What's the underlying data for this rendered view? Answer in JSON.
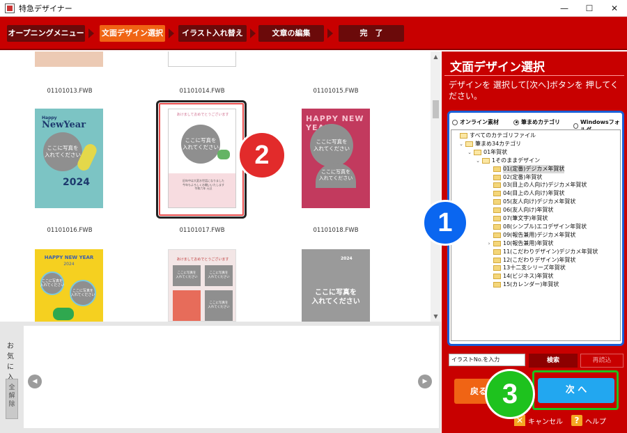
{
  "window": {
    "title": "特急デザイナー",
    "minimize": "—",
    "maximize": "☐",
    "close": "✕"
  },
  "steps": [
    {
      "label": "オープニングメニュー"
    },
    {
      "label": "文面デザイン選択"
    },
    {
      "label": "イラスト入れ替え"
    },
    {
      "label": "文章の編集"
    },
    {
      "label": "完　了"
    }
  ],
  "thumbnails": {
    "filenames": [
      "01101013.FWB",
      "01101014.FWB",
      "01101015.FWB",
      "01101016.FWB",
      "01101017.FWB",
      "01101018.FWB"
    ],
    "card1": {
      "brand": "Happy",
      "title": "NewYear",
      "photo": "ここに写真を\n入れてください",
      "year": "2024"
    },
    "card2": {
      "header": "あけましておめでとうございます",
      "photo": "ここに写真を\n入れてください",
      "msg": "旧年中は大変お世話になりました\n今年もよろしくお願いいたします\n令和六年 元旦"
    },
    "card3": {
      "title": "HAPPY NEW YEAR",
      "photo": "ここに写真を\n入れてください",
      "photo_small": "ここに写真を\n入れてください"
    },
    "card4": {
      "title": "HAPPY NEW YEAR",
      "year": "2024",
      "photo": "ここに写真を\n入れてください"
    },
    "card5": {
      "header": "あけましておめでとうございます",
      "photo": "ここに写真を\n入れてください"
    },
    "card6": {
      "year": "2024",
      "photo": "ここに写真を\n入れてください"
    }
  },
  "favorites": {
    "label": "お気に入り",
    "clear": "全解除",
    "prev": "◀",
    "next": "▶"
  },
  "panel": {
    "title": "文面デザイン選択",
    "description": "デザインを 選択して[次へ]ボタンを 押してください。",
    "radios": [
      {
        "label": "オンライン素材",
        "checked": false
      },
      {
        "label": "筆まめカテゴリ",
        "checked": true
      },
      {
        "label": "Windowsフォルダ",
        "checked": false
      }
    ],
    "tree": [
      {
        "label": "すべてのカテゴリファイル",
        "expander": "",
        "level": 0
      },
      {
        "label": "筆まめ34カテゴリ",
        "expander": "⌄",
        "level": 1
      },
      {
        "label": "01年賀状",
        "expander": "⌄",
        "level": 2
      },
      {
        "label": "1そのままデザイン",
        "expander": "⌄",
        "level": 3
      },
      {
        "label": "01(定番)デジカメ年賀状",
        "expander": "",
        "level": 4,
        "selected": true
      },
      {
        "label": "02(定番)年賀状",
        "expander": "",
        "level": 4
      },
      {
        "label": "03(目上の人向け)デジカメ年賀状",
        "expander": "",
        "level": 4
      },
      {
        "label": "04(目上の人向け)年賀状",
        "expander": "",
        "level": 4
      },
      {
        "label": "05(友人向け)デジカメ年賀状",
        "expander": "",
        "level": 4
      },
      {
        "label": "06(友人向け)年賀状",
        "expander": "",
        "level": 4
      },
      {
        "label": "07(筆文字)年賀状",
        "expander": "",
        "level": 4
      },
      {
        "label": "08(シンプル)エコデザイン年賀状",
        "expander": "",
        "level": 4
      },
      {
        "label": "09(報告兼用)デジカメ年賀状",
        "expander": "",
        "level": 4
      },
      {
        "label": "10(報告兼用)年賀状",
        "expander": "›",
        "level": 4
      },
      {
        "label": "11(こだわりデザイン)デジカメ年賀状",
        "expander": "",
        "level": 4
      },
      {
        "label": "12(こだわりデザイン)年賀状",
        "expander": "",
        "level": 4
      },
      {
        "label": "13十二支シリーズ年賀状",
        "expander": "",
        "level": 4
      },
      {
        "label": "14(ビジネス)年賀状",
        "expander": "",
        "level": 4
      },
      {
        "label": "15(カレンダー)年賀状",
        "expander": "",
        "level": 4
      }
    ],
    "search_placeholder": "イラストNo.を入力",
    "search_button": "検索",
    "reload_button": "再読込",
    "back_button": "戻る",
    "next_button": "次 へ",
    "cancel": "キャンセル",
    "help": "ヘルプ"
  },
  "callouts": [
    "1",
    "2",
    "3"
  ],
  "colors": {
    "brand_red": "#c80000",
    "active_step": "#f06414",
    "next_blue": "#22a7f0",
    "callout_blue": "#0a66f0",
    "callout_red": "#e22b2b",
    "callout_green": "#1ec21e"
  }
}
